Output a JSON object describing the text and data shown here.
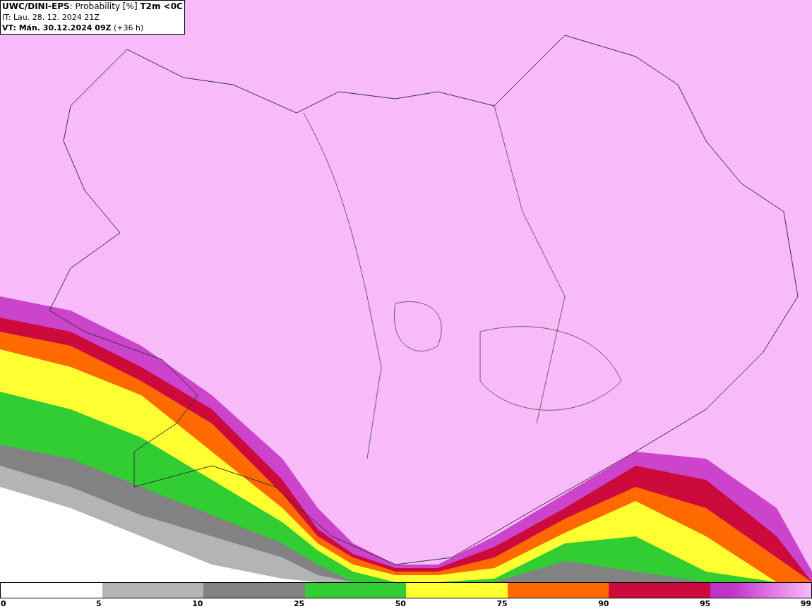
{
  "header": {
    "title": "**UWC/DINI-EPS**: Probability [%] **T2m <0C**",
    "init_time": "IT: Lau. 28. 12. 2024 21Z",
    "valid_time": "**VT: Mán. 30.12.2024 09Z** (+36 h)"
  },
  "legend": {
    "segments": [
      {
        "color": "#ffffff"
      },
      {
        "color": "#b4b4b4"
      },
      {
        "color": "#828282"
      },
      {
        "color": "#32cd32"
      },
      {
        "color": "#ffff32"
      },
      {
        "color": "#ff6a00"
      },
      {
        "color": "#cc0a3c"
      },
      {
        "color": "#c032c8"
      }
    ],
    "ticks": [
      "0",
      "5",
      "10",
      "25",
      "50",
      "75",
      "90",
      "95",
      "99"
    ]
  }
}
